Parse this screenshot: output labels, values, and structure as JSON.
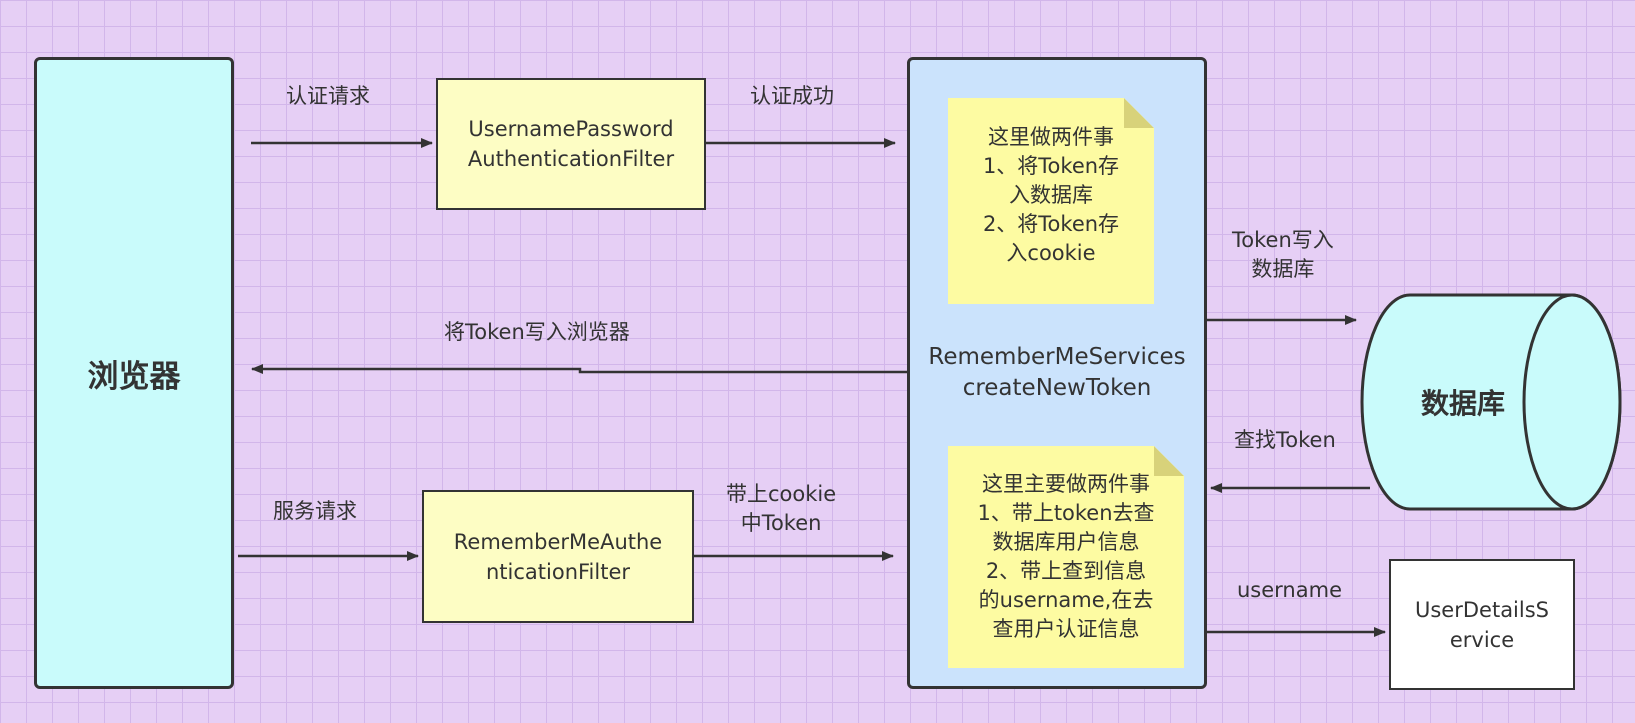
{
  "nodes": {
    "browser": "浏览器",
    "upa_filter": [
      "UsernamePassword",
      "AuthenticationFilter"
    ],
    "rma_filter": [
      "RememberMeAuthe",
      "nticationFilter"
    ],
    "services": [
      "RememberMeServices",
      "createNewToken"
    ],
    "database": "数据库",
    "user_details": [
      "UserDetailsS",
      "ervice"
    ]
  },
  "notes": {
    "create_token": [
      "这里做两件事",
      "1、将Token存",
      "入数据库",
      "2、将Token存",
      "入cookie"
    ],
    "auto_login": [
      "这里主要做两件事",
      "1、带上token去查",
      "数据库用户信息",
      "2、带上查到信息",
      "的username,在去",
      "查用户认证信息"
    ]
  },
  "edge_labels": {
    "auth_request": "认证请求",
    "auth_success": "认证成功",
    "write_token_browser": "将Token写入浏览器",
    "write_token_db": [
      "Token写入",
      "数据库"
    ],
    "find_token": "查找Token",
    "service_request": "服务请求",
    "with_cookie": [
      "带上cookie",
      "中Token"
    ],
    "username": "username"
  },
  "colors": {
    "background": "#e6cff5",
    "browser_fill": "#c9fbfb",
    "filter_fill": "#fdfdc4",
    "services_fill": "#cbe3fc",
    "note_fill": "#fdfba2",
    "database_fill": "#c9fbfb",
    "stroke": "#333333"
  }
}
